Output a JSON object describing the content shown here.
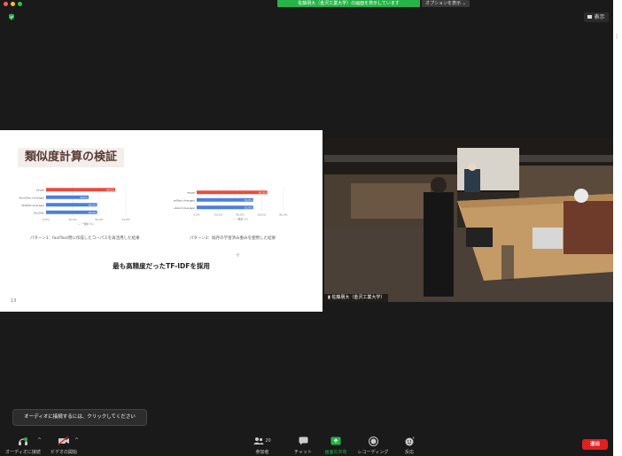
{
  "banner": {
    "sharing_text": "佐藤朋大（金沢工業大学）の画面を表示しています",
    "options_label": "オプションを表示"
  },
  "view": {
    "label": "表示"
  },
  "colors": {
    "share_green": "#27b24a",
    "end_red": "#e02020",
    "bar_red": "#e84c3d",
    "bar_blue": "#4a7fe0"
  },
  "slide": {
    "title": "類似度計算の検証",
    "conclusion": "最も高精度だったTF-IDFを採用",
    "page_number": "13",
    "captions": [
      "パターン1：fastText用に作成したコーパスを再活用した結果",
      "パターン2：既存の学習済み重みを使用した結果"
    ]
  },
  "chart_data": [
    {
      "type": "bar",
      "orientation": "horizontal",
      "categories": [
        "TF-IDF",
        "Word2Vec (Average)",
        "fastText (Average)",
        "Doc2Vec"
      ],
      "values": [
        65.0,
        40.0,
        48.0,
        48.0
      ],
      "value_labels": [
        "65.0%",
        "40.0%",
        "48.0%",
        "48.0%"
      ],
      "series_colors": [
        "#e84c3d",
        "#4a7fe0",
        "#4a7fe0",
        "#4a7fe0"
      ],
      "xlim": [
        0,
        75
      ],
      "xticks": [
        "0.0%",
        "25.0%",
        "50.0%",
        "75.0%"
      ],
      "legend": "一致率 (%)"
    },
    {
      "type": "bar",
      "orientation": "horizontal",
      "categories": [
        "TF-IDF",
        "fastText (Average)",
        "fastText (Subword Average)"
      ],
      "values": [
        65.0,
        52.0,
        52.0
      ],
      "value_labels": [
        "65.0%",
        "52.0%",
        "52.0%"
      ],
      "series_colors": [
        "#e84c3d",
        "#4a7fe0",
        "#4a7fe0"
      ],
      "xlim": [
        0,
        80
      ],
      "xticks": [
        "0.0%",
        "20.0%",
        "40.0%",
        "60.0%",
        "80.0%"
      ],
      "legend": "一致率 (%)"
    }
  ],
  "video": {
    "participant_name": "佐藤朋大（金沢工業大学）"
  },
  "audio_tip": {
    "text": "オーディオに接続するには、クリックしてください"
  },
  "toolbar": {
    "audio_label": "オーディオに接続",
    "video_label": "ビデオの開始",
    "participants_label": "参加者",
    "participants_count": "20",
    "chat_label": "チャット",
    "share_label": "画面の共有",
    "record_label": "レコーディング",
    "reactions_label": "反応",
    "end_label": "退出"
  }
}
